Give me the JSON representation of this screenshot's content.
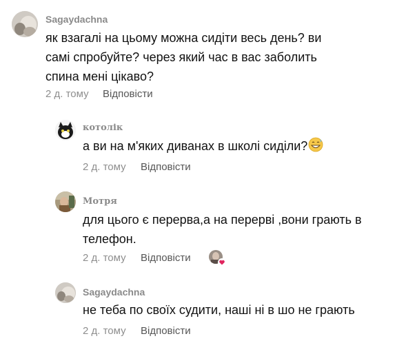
{
  "comments": [
    {
      "author": "Sagaydachna",
      "text": "як взагалі на цьому можна сидіти весь день? ви самі спробуйте? через який час в вас заболить спина мені цікаво?",
      "time": "2 д. тому",
      "reply_label": "Відповісти"
    },
    {
      "author": "котолік",
      "text": "а ви на м'яких диванах в школі сиділи?",
      "time": "2 д. тому",
      "reply_label": "Відповісти",
      "emoji": "grinning-sweat-emoji"
    },
    {
      "author": "Мотря",
      "text": "для цього є перерва,а на перерві ,вони грають в телефон.",
      "time": "2 д. тому",
      "reply_label": "Відповісти",
      "liked_by_author": true
    },
    {
      "author": "Sagaydachna",
      "text": "не теба по своїх судити, наші ні в шо не грають",
      "time": "2 д. тому",
      "reply_label": "Відповісти"
    }
  ],
  "colors": {
    "meta": "#8e8e8e",
    "heart": "#e0245e"
  }
}
